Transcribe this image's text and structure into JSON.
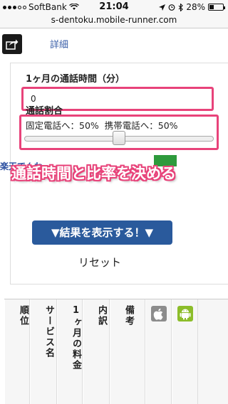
{
  "status_bar": {
    "carrier": "SoftBank",
    "time": "21:04",
    "battery": "28%",
    "battery_level": 0.28,
    "icons": [
      "wifi-icon",
      "location-icon",
      "alarm-icon",
      "bluetooth-icon",
      "battery-icon"
    ]
  },
  "url_bar": {
    "url": "s-dentoku.mobile-runner.com"
  },
  "toolbar": {
    "share_icon": "share-icon",
    "detail_label": "詳細"
  },
  "form": {
    "minutes_label": "1ヶ月の通話時間（分）",
    "minutes_value": "0",
    "ratio_label": "通話割合",
    "landline_label": "固定電話へ：50%",
    "mobile_label": "携帯電話へ：50%",
    "ratio_value": 0.5,
    "submit_label": "▼結果を表示する！▼",
    "reset_label": "リセット"
  },
  "obscured": {
    "partial_text": "楽天でんわ"
  },
  "caption": {
    "text": "通話時間と比率を決める"
  },
  "table": {
    "headers": [
      "順位",
      "サービス名",
      "1ヶ月の料金",
      "内訳",
      "備考"
    ],
    "icon_columns": [
      "apple-icon",
      "android-icon"
    ]
  },
  "colors": {
    "highlight": "#e8437a",
    "button": "#2a5a9c",
    "link": "#3a5fa8",
    "android": "#8cbd2a"
  }
}
